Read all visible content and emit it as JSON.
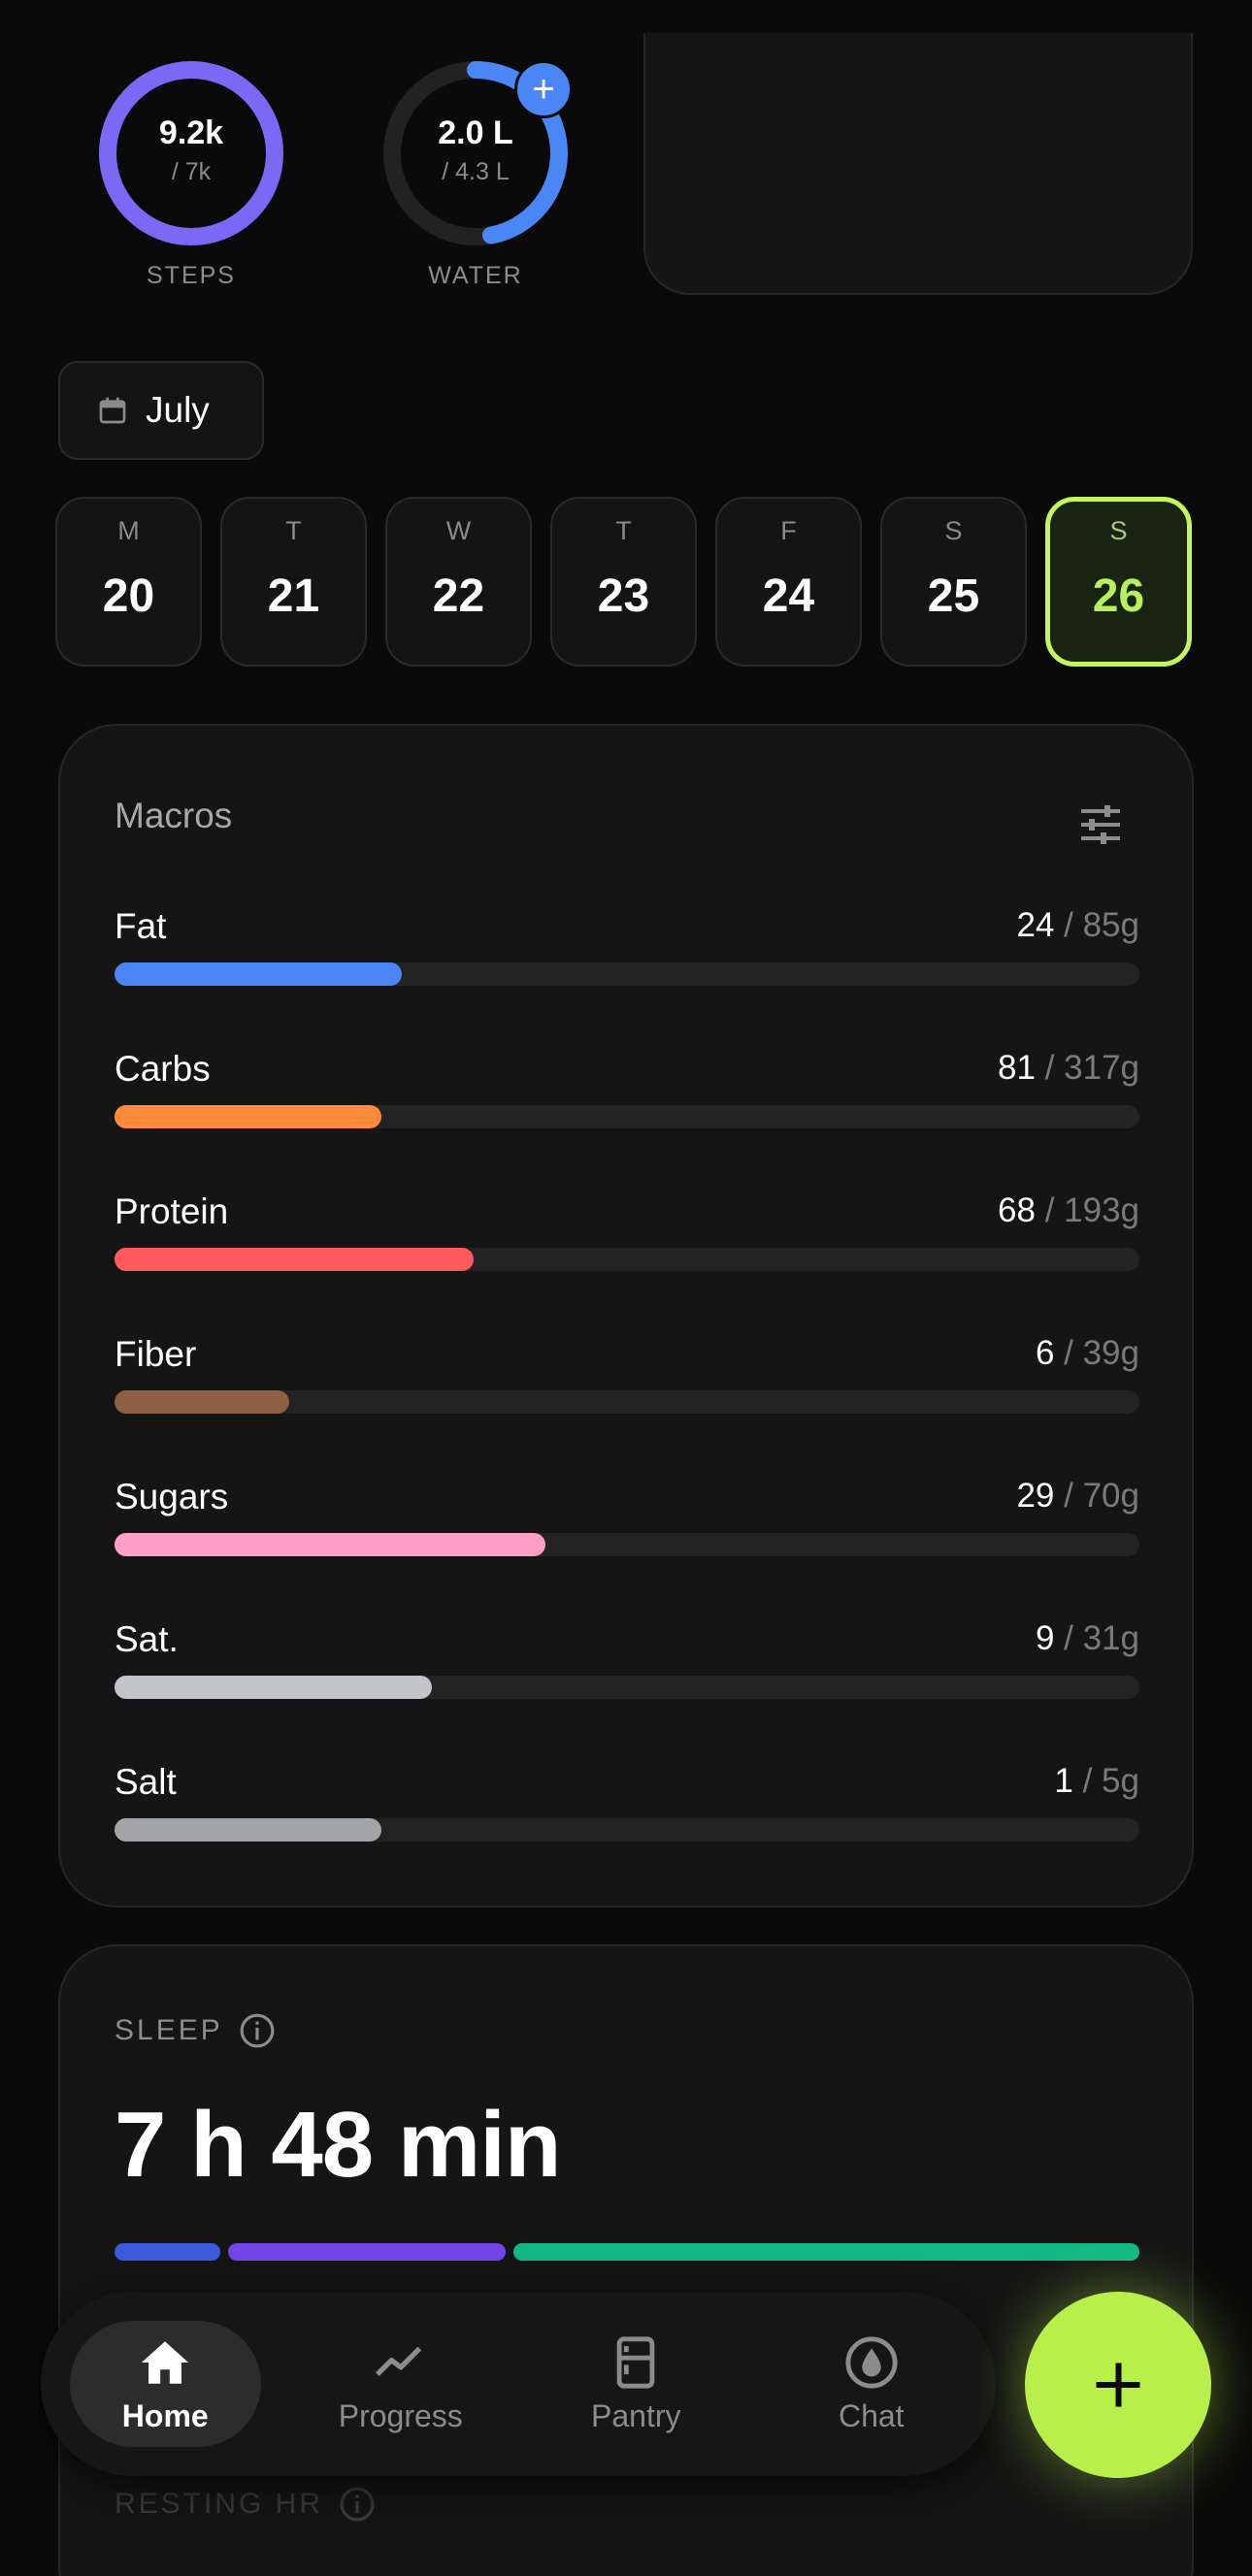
{
  "top": {
    "steps": {
      "value": "9.2k",
      "goal": "/ 7k",
      "label": "STEPS",
      "progress": 1.0,
      "color": "#7b68f5"
    },
    "water": {
      "value": "2.0 L",
      "goal": "/ 4.3 L",
      "label": "WATER",
      "progress": 0.47,
      "color": "#4b86f7",
      "add_label": "+"
    }
  },
  "month": {
    "label": "July"
  },
  "days": [
    {
      "dow": "M",
      "num": "20",
      "selected": false
    },
    {
      "dow": "T",
      "num": "21",
      "selected": false
    },
    {
      "dow": "W",
      "num": "22",
      "selected": false
    },
    {
      "dow": "T",
      "num": "23",
      "selected": false
    },
    {
      "dow": "F",
      "num": "24",
      "selected": false
    },
    {
      "dow": "S",
      "num": "25",
      "selected": false
    },
    {
      "dow": "S",
      "num": "26",
      "selected": true
    }
  ],
  "macros": {
    "title": "Macros",
    "items": [
      {
        "name": "Fat",
        "current": "24",
        "total": "/ 85g",
        "progress": 0.28,
        "color": "#4b86f7"
      },
      {
        "name": "Carbs",
        "current": "81",
        "total": "/ 317g",
        "progress": 0.26,
        "color": "#ff8a3c"
      },
      {
        "name": "Protein",
        "current": "68",
        "total": "/ 193g",
        "progress": 0.35,
        "color": "#ff5a5f"
      },
      {
        "name": "Fiber",
        "current": "6",
        "total": "/ 39g",
        "progress": 0.17,
        "color": "#8d5f44"
      },
      {
        "name": "Sugars",
        "current": "29",
        "total": "/ 70g",
        "progress": 0.42,
        "color": "#ff9ec6"
      },
      {
        "name": "Sat.",
        "current": "9",
        "total": "/ 31g",
        "progress": 0.31,
        "color": "#c4c5c9"
      },
      {
        "name": "Salt",
        "current": "1",
        "total": "/ 5g",
        "progress": 0.26,
        "color": "#a3a4a8"
      }
    ]
  },
  "sleep": {
    "label": "SLEEP",
    "value": "7 h 48 min",
    "segments": [
      {
        "share": 0.105,
        "color": "#3b5bdb"
      },
      {
        "share": 0.275,
        "color": "#7048e8"
      },
      {
        "share": 0.62,
        "color": "#12b886"
      }
    ]
  },
  "resting": {
    "label": "RESTING HR"
  },
  "nav": {
    "items": [
      {
        "label": "Home",
        "icon": "home-icon",
        "active": true
      },
      {
        "label": "Progress",
        "icon": "trend-icon",
        "active": false
      },
      {
        "label": "Pantry",
        "icon": "fridge-icon",
        "active": false
      },
      {
        "label": "Chat",
        "icon": "chat-drop-icon",
        "active": false
      }
    ]
  },
  "fab": {
    "label": "+"
  }
}
